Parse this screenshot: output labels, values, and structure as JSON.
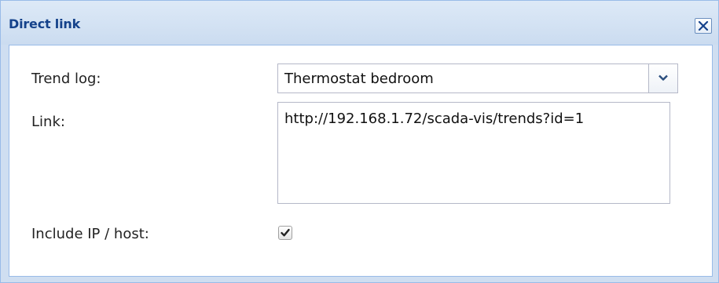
{
  "window": {
    "title": "Direct link",
    "close_icon": "close-icon"
  },
  "form": {
    "trend_log_label": "Trend log:",
    "trend_log_value": "Thermostat bedroom",
    "link_label": "Link:",
    "link_value": "http://192.168.1.72/scada-vis/trends?id=1",
    "include_host_label": "Include IP / host:",
    "include_host_checked": true
  },
  "colors": {
    "title_text": "#15428b",
    "frame_border": "#99bbe8",
    "frame_background": "#cfdef1",
    "field_border": "#b5b8c8"
  }
}
